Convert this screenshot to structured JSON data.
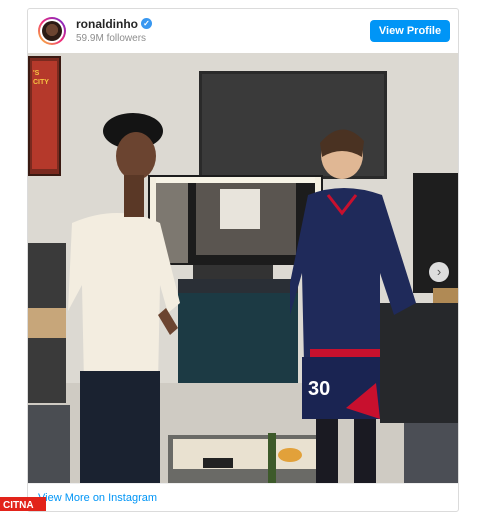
{
  "post": {
    "username": "ronaldinho",
    "followers": "59.9M followers",
    "verified_icon": "check-icon",
    "view_profile_label": "View Profile",
    "view_more_label": "View More on Instagram",
    "next_icon": "chevron-right-icon"
  },
  "poster": {
    "text_line1": "'S",
    "text_line2": "CITY"
  },
  "shirt_number": "30",
  "watermark": {
    "text": "CITNA",
    "color": "#e2231a"
  },
  "colors": {
    "accent": "#0095f6",
    "verified": "#3897f0",
    "jacket": "#1f2a5a",
    "stripe": "#c8102e"
  }
}
